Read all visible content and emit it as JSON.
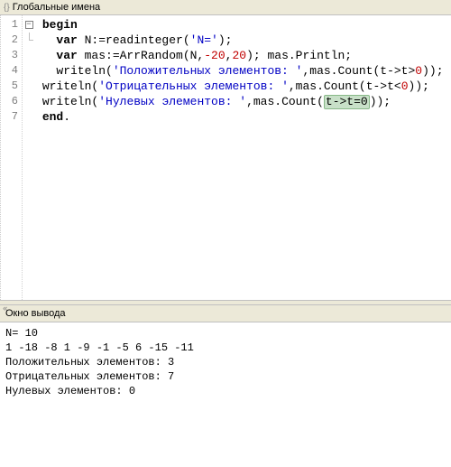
{
  "tabs": {
    "global_names": "Глобальные имена"
  },
  "gutter": [
    "1",
    "2",
    "3",
    "4",
    "5",
    "6",
    "7"
  ],
  "code": {
    "l1": {
      "kw": "begin"
    },
    "l2": {
      "kw": "var",
      "t1": " N:=readinteger(",
      "s1": "'N='",
      "t2": ");"
    },
    "l3": {
      "kw": "var",
      "t1": " mas:=ArrRandom(N,",
      "n1": "-20",
      "t2": ",",
      "n2": "20",
      "t3": "); mas.Println;"
    },
    "l4": {
      "t1": "writeln(",
      "s1": "'Положительных элементов: '",
      "t2": ",mas.Count(t->t>",
      "n1": "0",
      "t3": "));"
    },
    "l5": {
      "t1": "writeln(",
      "s1": "'Отрицательных элементов: '",
      "t2": ",mas.Count(t->t<",
      "n1": "0",
      "t3": "));"
    },
    "l6": {
      "t1": "writeln(",
      "s1": "'Нулевых элементов: '",
      "t2": ",mas.Count(",
      "h1": "t->t=0",
      "t3": "));"
    },
    "l7": {
      "kw": "end",
      "t1": "."
    }
  },
  "output": {
    "title": "Окно вывода",
    "lines": "N= 10\n1 -18 -8 1 -9 -1 -5 6 -15 -11\nПоложительных элементов: 3\nОтрицательных элементов: 7\nНулевых элементов: 0"
  },
  "corner": "«"
}
